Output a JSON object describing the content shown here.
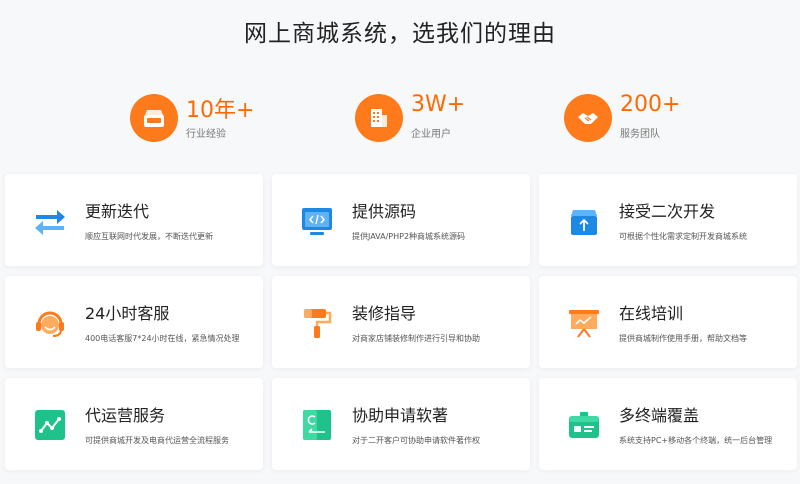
{
  "heading": "网上商城系统，选我们的理由",
  "stats": [
    {
      "value": "10年+",
      "label": "行业经验",
      "icon": "storefront-icon"
    },
    {
      "value": "3W+",
      "label": "企业用户",
      "icon": "building-icon"
    },
    {
      "value": "200+",
      "label": "服务团队",
      "icon": "handshake-icon"
    }
  ],
  "features": [
    {
      "title": "更新迭代",
      "desc": "顺应互联网时代发展，不断迭代更新",
      "icon": "swap-arrows-icon"
    },
    {
      "title": "提供源码",
      "desc": "提供JAVA/PHP2种商城系统源码",
      "icon": "code-window-icon"
    },
    {
      "title": "接受二次开发",
      "desc": "可根据个性化需求定制开发商城系统",
      "icon": "upload-box-icon"
    },
    {
      "title": "24小时客服",
      "desc": "400电话客服7*24小时在线，紧急情况处理",
      "icon": "headset-icon"
    },
    {
      "title": "装修指导",
      "desc": "对商家店铺装修制作进行引导和协助",
      "icon": "paint-roller-icon"
    },
    {
      "title": "在线培训",
      "desc": "提供商城制作使用手册，帮助文档等",
      "icon": "presentation-board-icon"
    },
    {
      "title": "代运营服务",
      "desc": "可提供商城开发及电商代运营全流程服务",
      "icon": "line-chart-icon"
    },
    {
      "title": "协助申请软著",
      "desc": "对于二开客户可协助申请软件著作权",
      "icon": "copyright-doc-icon"
    },
    {
      "title": "多终端覆盖",
      "desc": "系统支持PC+移动各个终端，统一后台管理",
      "icon": "id-card-icon"
    }
  ],
  "colors": {
    "accent": "#ff6a00",
    "blue": "#1e88e5",
    "green": "#1fc28a",
    "orange": "#ff7a1a"
  }
}
